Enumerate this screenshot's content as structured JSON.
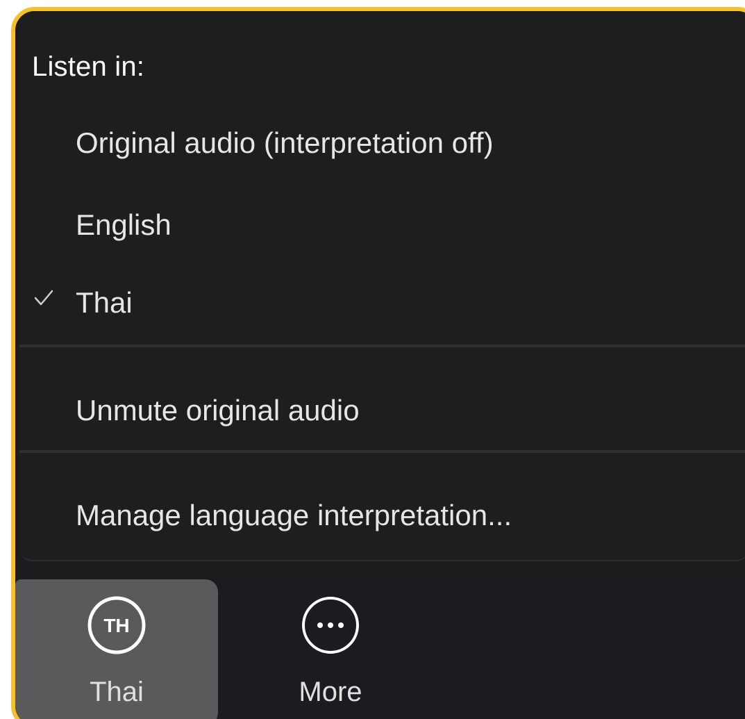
{
  "menu": {
    "header": "Listen in:",
    "items": [
      {
        "label": "Original audio (interpretation off)",
        "checked": false
      },
      {
        "label": "English",
        "checked": false
      },
      {
        "label": "Thai",
        "checked": true
      }
    ],
    "unmute_label": "Unmute original audio",
    "manage_label": "Manage language interpretation..."
  },
  "toolbar": {
    "thai_button": {
      "icon_text": "TH",
      "label": "Thai",
      "active": true
    },
    "more_button": {
      "icon": "ellipsis-icon",
      "label": "More"
    }
  },
  "colors": {
    "highlight_border": "#f5c02c",
    "menu_background": "#1e1e1f",
    "active_button": "#5a5a5d"
  }
}
